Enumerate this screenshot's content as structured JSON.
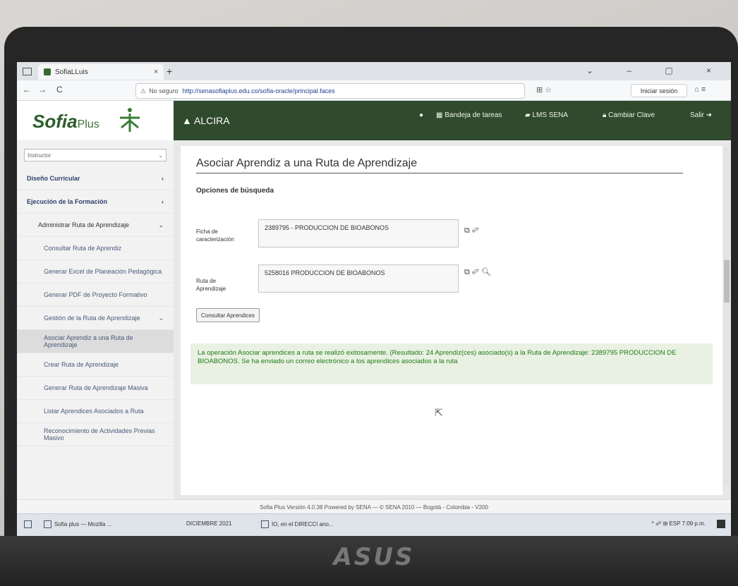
{
  "browser": {
    "tab_title": "SofiaLLuis",
    "tab_close": "×",
    "new_tab": "+",
    "window_controls": "⌄ – ▢ ×",
    "back": "←",
    "forward": "→",
    "reload": "C",
    "not_secure": "No seguro",
    "url": "http://senasofiaplus.edu.co/sofia-oracle/principal.faces",
    "signin_label": "Iniciar sesión",
    "toolbar_icons": "⊞ ☆",
    "toolbar_right_icons": "⌂ ≡"
  },
  "app": {
    "logo_main": "Sofia",
    "logo_sub": "Plus",
    "user_name": "ALCIRA",
    "help_icon": "help-icon",
    "top_menu": [
      {
        "label": "Bandeja de tareas",
        "icon": "inbox-icon"
      },
      {
        "label": "LMS SENA",
        "icon": "graduation-icon"
      },
      {
        "label": "Cambiar Clave",
        "icon": "lock-icon"
      },
      {
        "label": "Salir",
        "icon": "logout-icon"
      }
    ],
    "side_select": "Instructor",
    "side_items": [
      {
        "label": "Diseño Curricular",
        "level": "head",
        "arrow": "‹"
      },
      {
        "label": "Ejecución de la Formación",
        "level": "head",
        "arrow": "‹"
      },
      {
        "label": "Administrar Ruta de Aprendizaje",
        "level": "l2",
        "arrow": "⌄"
      },
      {
        "label": "Consultar Ruta de Aprendiz",
        "level": "l3",
        "arrow": ""
      },
      {
        "label": "Generar Excel de Planeación Pedagógica",
        "level": "l3",
        "arrow": ""
      },
      {
        "label": "Generar PDF de Proyecto Formativo",
        "level": "l3",
        "arrow": ""
      },
      {
        "label": "Gestión de la Ruta de Aprendizaje",
        "level": "l3",
        "arrow": "⌄"
      },
      {
        "label": "Asociar Aprendiz a una Ruta de Aprendizaje",
        "level": "l3 active",
        "arrow": ""
      },
      {
        "label": "Crear Ruta de Aprendizaje",
        "level": "l3",
        "arrow": ""
      },
      {
        "label": "Generar Ruta de Aprendizaje Masiva",
        "level": "l3",
        "arrow": ""
      },
      {
        "label": "Listar Aprendices Asociados a Ruta",
        "level": "l3",
        "arrow": ""
      },
      {
        "label": "Reconocimiento de Actividades Previas Masivo",
        "level": "l3",
        "arrow": ""
      }
    ],
    "page_title": "Asociar Aprendiz a una Ruta de Aprendizaje",
    "section_title": "Opciones de búsqueda",
    "field1_label": "Ficha de caracterización",
    "field1_value": "2389795 - PRODUCCION DE BIOABONOS",
    "field2_label": "Ruta de Aprendizaje",
    "field2_value": "5258016 PRODUCCION DE BIOABONOS",
    "field1_icons": "⧉ ✐",
    "field2_icons": "⧉ ✐ 🔍︎",
    "consult_button": "Consultar Aprendices",
    "success_message": "La operación Asociar aprendices a ruta se realizó exitosamente. (Resultado: 24 Aprendiz(ces) asociado(s) a la Ruta de Aprendizaje: 2389795 PRODUCCION DE BIOABONOS. Se ha enviado un correo electrónico a los aprendices asociados a la ruta",
    "cursor": "⇱",
    "footer": "Sofia Plus Versión 4.0.38 Powered by SENA — © SENA 2010 — Bogotá - Colombia - V200"
  },
  "taskbar": {
    "item1": "Sofia plus — Mozilla ...",
    "item2": "DICIEMBRE 2021",
    "item3": "IO, en el DIRECCI ano...",
    "tray": "^ ☍ ⊞ ESP 7:09 p.m."
  },
  "device_brand": "ASUS",
  "colors": {
    "topbar": "#2f4a2d",
    "success_bg": "#e9f1e3",
    "success_text": "#1f7a14",
    "sidebar_bg": "#f2f2f2"
  }
}
